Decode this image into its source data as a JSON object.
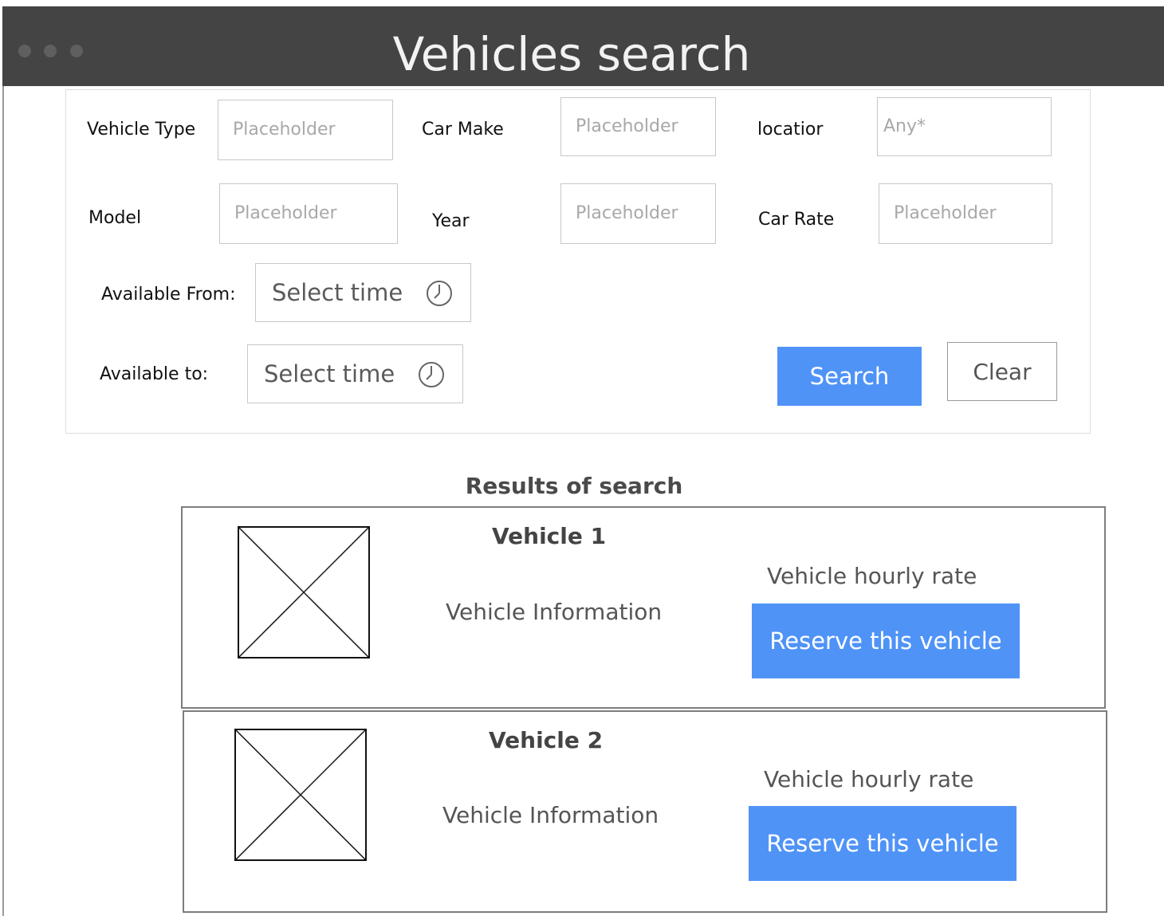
{
  "window": {
    "title": "Vehicles search"
  },
  "form": {
    "vehicle_type": {
      "label": "Vehicle Type",
      "placeholder": "Placeholder"
    },
    "car_make": {
      "label": "Car Make",
      "placeholder": "Placeholder"
    },
    "location": {
      "label": "locatior",
      "placeholder": "Any*"
    },
    "model": {
      "label": "Model",
      "placeholder": "Placeholder"
    },
    "year": {
      "label": "Year",
      "placeholder": "Placeholder"
    },
    "car_rate": {
      "label": "Car Rate",
      "placeholder": "Placeholder"
    },
    "available_from": {
      "label": "Available From:",
      "value": "Select time"
    },
    "available_to": {
      "label": "Available to:",
      "value": "Select time"
    },
    "search_label": "Search",
    "clear_label": "Clear"
  },
  "results": {
    "heading": "Results of search",
    "items": [
      {
        "title": "Vehicle 1",
        "info": "Vehicle Information",
        "rate": "Vehicle hourly rate",
        "reserve_label": "Reserve this vehicle"
      },
      {
        "title": "Vehicle 2",
        "info": "Vehicle Information",
        "rate": "Vehicle hourly rate",
        "reserve_label": "Reserve this vehicle"
      }
    ]
  },
  "colors": {
    "titlebar": "#444444",
    "primary_button": "#4f93f7"
  },
  "icons": {
    "time_picker": "clock-icon",
    "image_placeholder": "image-placeholder-icon"
  }
}
